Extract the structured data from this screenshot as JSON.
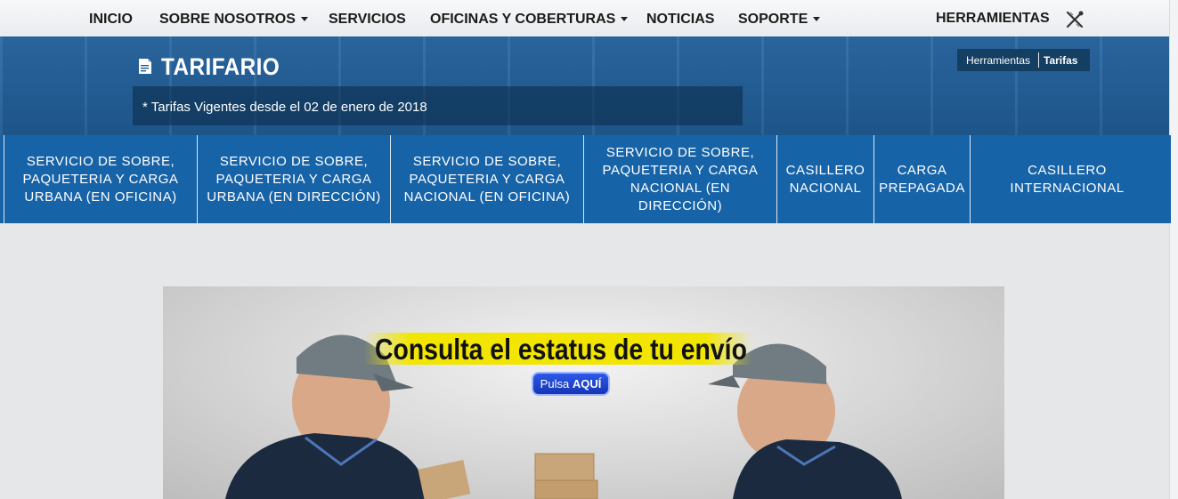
{
  "nav": {
    "items": [
      {
        "label": "INICIO",
        "dropdown": false
      },
      {
        "label": "SOBRE NOSOTROS",
        "dropdown": true
      },
      {
        "label": "SERVICIOS",
        "dropdown": false
      },
      {
        "label": "OFICINAS Y COBERTURAS",
        "dropdown": true
      },
      {
        "label": "NOTICIAS",
        "dropdown": false
      },
      {
        "label": "SOPORTE",
        "dropdown": true
      }
    ],
    "tools_label": "HERRAMIENTAS",
    "tools_icon": "tools-icon"
  },
  "header": {
    "title": "TARIFARIO",
    "title_icon": "document-icon",
    "subtitle": "* Tarifas Vigentes desde el 02 de enero de 2018",
    "breadcrumb": [
      "Herramientas",
      "Tarifas"
    ]
  },
  "tabs": [
    "SERVICIO DE SOBRE, PAQUETERIA Y CARGA URBANA (EN OFICINA)",
    "SERVICIO DE SOBRE, PAQUETERIA Y CARGA URBANA (EN DIRECCIÓN)",
    "SERVICIO DE SOBRE, PAQUETERIA Y CARGA NACIONAL (EN OFICINA)",
    "SERVICIO DE SOBRE, PAQUETERIA Y CARGA NACIONAL (EN DIRECCIÓN)",
    "CASILLERO NACIONAL",
    "CARGA PREPAGADA",
    "CASILLERO INTERNACIONAL"
  ],
  "banner": {
    "headline": "Consulta el estatus de tu envío",
    "button_prefix": "Pulsa",
    "button_emphasis": "AQUÍ"
  },
  "colors": {
    "header_blue": "#1f5a92",
    "tab_blue": "#1763a8",
    "banner_yellow": "#f2e600",
    "button_blue": "#1636b6"
  }
}
